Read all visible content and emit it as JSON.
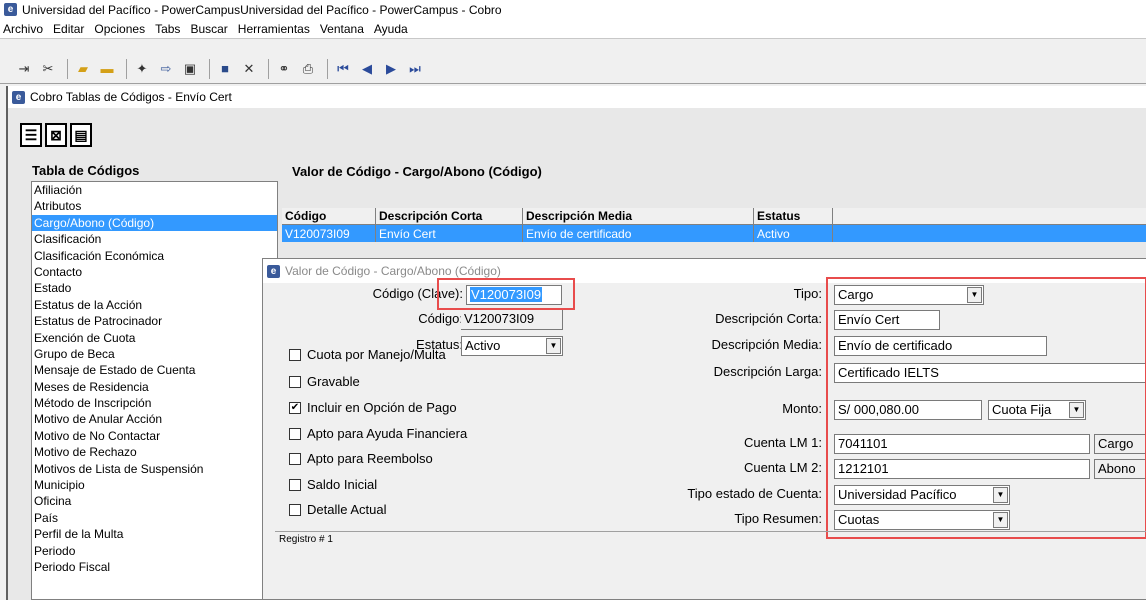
{
  "app": {
    "title": "Universidad del Pacífico - PowerCampusUniversidad del Pacífico - PowerCampus - Cobro",
    "icon_letter": "e"
  },
  "menu": [
    "Archivo",
    "Editar",
    "Opciones",
    "Tabs",
    "Buscar",
    "Herramientas",
    "Ventana",
    "Ayuda"
  ],
  "toolbar_icons": [
    "exit-icon",
    "tools-icon",
    "open-folder-icon",
    "folder-icon",
    "new-icon",
    "import-icon",
    "export-icon",
    "save-icon",
    "delete-icon",
    "binoculars-icon",
    "print-icon",
    "first-record-icon",
    "previous-record-icon",
    "next-record-icon",
    "last-record-icon"
  ],
  "child_window": {
    "title": "Cobro Tablas de Códigos -  Envío Cert",
    "code_table_heading": "Tabla de Códigos",
    "code_items": [
      "Afiliación",
      "Atributos",
      "Cargo/Abono (Código)",
      "Clasificación",
      "Clasificación Económica",
      "Contacto",
      "Estado",
      "Estatus de la Acción",
      "Estatus de Patrocinador",
      "Exención de Cuota",
      "Grupo de Beca",
      "Mensaje de Estado de Cuenta",
      "Meses de Residencia",
      "Método de Inscripción",
      "Motivo de Anular Acción",
      "Motivo de No Contactar",
      "Motivo de Rechazo",
      "Motivos de Lista de Suspensión",
      "Municipio",
      "Oficina",
      "País",
      "Perfil de la Multa",
      "Periodo",
      "Periodo Fiscal"
    ],
    "selected_index": 2,
    "valor_heading": "Valor de Código - Cargo/Abono (Código)",
    "grid": {
      "headers": [
        "Código",
        "Descripción Corta",
        "Descripción Media",
        "Estatus"
      ],
      "rows": [
        [
          "V120073I09",
          "Envío Cert",
          "Envío de certificado",
          "Activo"
        ]
      ]
    }
  },
  "dialog": {
    "title": "Valor de Código - Cargo/Abono (Código)",
    "codigo_clave_label": "Código (Clave):",
    "codigo_clave_value": "V120073I09",
    "codigo_label": "Código:",
    "codigo_value": "V120073I09",
    "estatus_label": "Estatus:",
    "estatus_value": "Activo",
    "checkboxes": [
      {
        "label": "Cuota por Manejo/Multa",
        "checked": false
      },
      {
        "label": "Gravable",
        "checked": false
      },
      {
        "label": "Incluir en Opción de Pago",
        "checked": true
      },
      {
        "label": "Apto para Ayuda Financiera",
        "checked": false
      },
      {
        "label": "Apto para Reembolso",
        "checked": false
      },
      {
        "label": "Saldo Inicial",
        "checked": false
      },
      {
        "label": "Detalle Actual",
        "checked": false
      }
    ],
    "tipo_label": "Tipo:",
    "tipo_value": "Cargo",
    "desc_corta_label": "Descripción Corta:",
    "desc_corta_value": "Envío Cert",
    "desc_media_label": "Descripción Media:",
    "desc_media_value": "Envío de certificado",
    "desc_larga_label": "Descripción Larga:",
    "desc_larga_value": "Certificado IELTS",
    "monto_label": "Monto:",
    "monto_value": "S/ 000,080.00",
    "cuota_value": "Cuota Fija",
    "cuenta1_label": "Cuenta LM 1:",
    "cuenta1_value": "7041101",
    "cuenta1_type": "Cargo",
    "cuenta2_label": "Cuenta LM 2:",
    "cuenta2_value": "1212101",
    "cuenta2_type": "Abono",
    "tipo_estado_label": "Tipo estado de Cuenta:",
    "tipo_estado_value": "Universidad Pacífico",
    "tipo_resumen_label": "Tipo Resumen:",
    "tipo_resumen_value": "Cuotas",
    "status_text": "Registro  # 1"
  },
  "colors": {
    "selection": "#3399ff",
    "highlight_box": "#e84c4c"
  }
}
